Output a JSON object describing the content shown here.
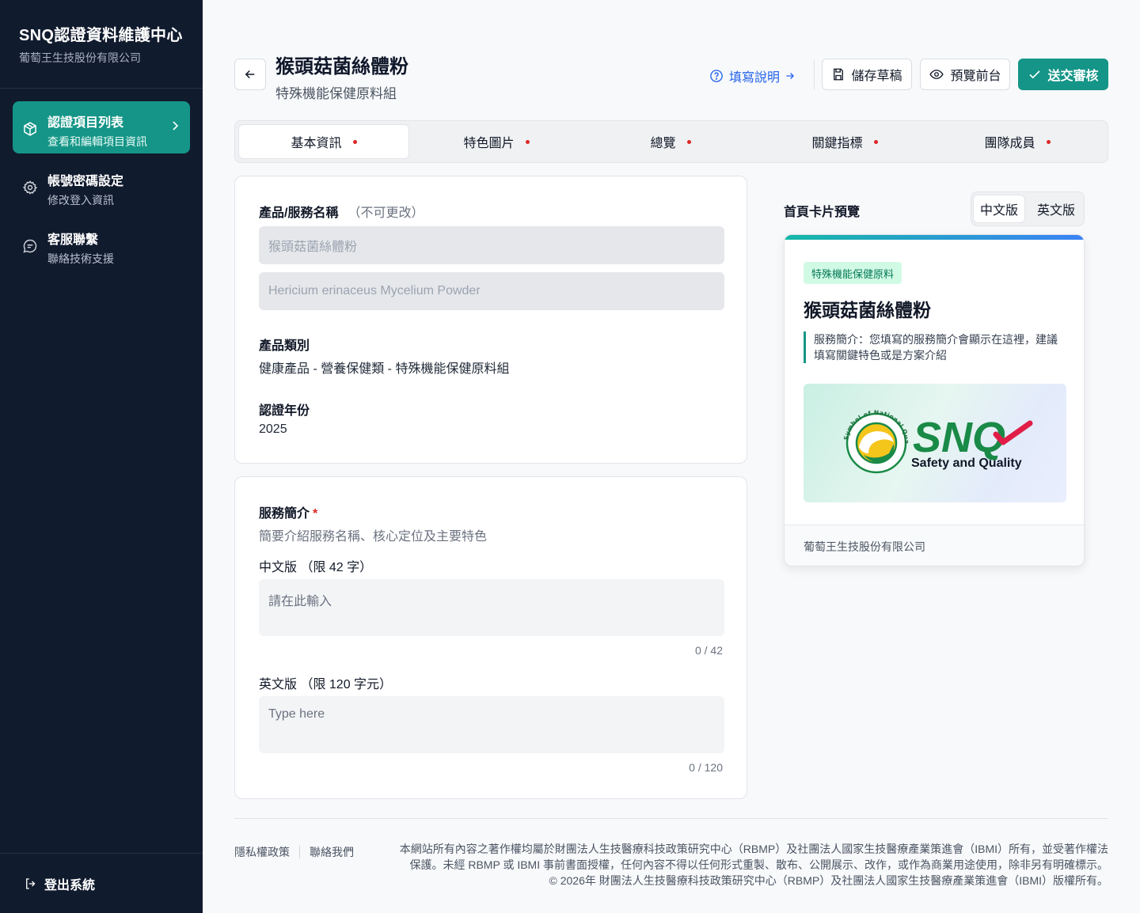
{
  "sidebar": {
    "brand_title": "SNQ認證資料維護中心",
    "brand_sub": "葡萄王生技股份有限公司",
    "items": [
      {
        "label": "認證項目列表",
        "desc": "查看和編輯項目資訊",
        "icon": "cube-icon",
        "active": true
      },
      {
        "label": "帳號密碼設定",
        "desc": "修改登入資訊",
        "icon": "gear-icon",
        "active": false
      },
      {
        "label": "客服聯繫",
        "desc": "聯絡技術支援",
        "icon": "chat-icon",
        "active": false
      }
    ],
    "logout_label": "登出系統"
  },
  "header": {
    "title": "猴頭菇菌絲體粉",
    "subtitle": "特殊機能保健原料組",
    "guide_link": "填寫說明",
    "save_draft": "儲存草稿",
    "preview_front": "預覽前台",
    "submit": "送交審核"
  },
  "tabs": [
    {
      "label": "基本資訊",
      "active": true
    },
    {
      "label": "特色圖片",
      "active": false
    },
    {
      "label": "總覽",
      "active": false
    },
    {
      "label": "關鍵指標",
      "active": false
    },
    {
      "label": "團隊成員",
      "active": false
    }
  ],
  "basic": {
    "name_label": "產品/服務名稱",
    "name_note": "（不可更改）",
    "name_zh": "猴頭菇菌絲體粉",
    "name_en": "Hericium erinaceus Mycelium Powder",
    "category_label": "產品類別",
    "category_value": "健康產品 - 營養保健類 - 特殊機能保健原料組",
    "year_label": "認證年份",
    "year_value": "2025"
  },
  "service": {
    "label": "服務簡介",
    "required_mark": "*",
    "help": "簡要介紹服務名稱、核心定位及主要特色",
    "zh_label": "中文版 （限 42 字）",
    "zh_placeholder": "請在此輸入",
    "zh_counter": "0 / 42",
    "en_label": "英文版 （限 120 字元）",
    "en_placeholder": "Type here",
    "en_counter": "0 / 120"
  },
  "preview": {
    "title": "首頁卡片預覽",
    "lang_zh": "中文版",
    "lang_en": "英文版",
    "badge": "特殊機能保健原料",
    "name": "猴頭菇菌絲體粉",
    "desc": "服務簡介：您填寫的服務簡介會顯示在這裡，建議填寫關鍵特色或是方案介紹",
    "logo_text": "SNQ",
    "logo_tagline": "Safety and Quality",
    "logo_ring_text": "Symbol of National Quality",
    "company": "葡萄王生技股份有限公司"
  },
  "footer": {
    "privacy": "隱私權政策",
    "contact": "聯絡我們",
    "copy_line1": "本網站所有內容之著作權均屬於財團法人生技醫療科技政策研究中心（RBMP）及社團法人國家生技醫療產業策進會（IBMI）所有，並受著作權法",
    "copy_line2": "保護。未經 RBMP 或 IBMI 事前書面授權，任何內容不得以任何形式重製、散布、公開展示、改作，或作為商業用途使用，除非另有明確標示。",
    "copy_line3": "© 2026年 財團法人生技醫療科技政策研究中心（RBMP）及社團法人國家生技醫療產業策進會（IBMI）版權所有。"
  },
  "colors": {
    "accent": "#149587",
    "sidebar_bg": "#111b2e",
    "required": "#dc2626",
    "link": "#2563eb"
  }
}
